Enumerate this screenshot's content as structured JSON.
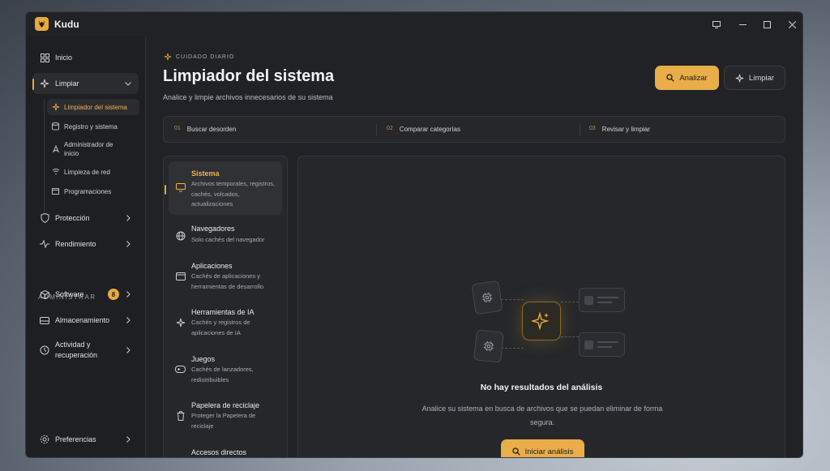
{
  "app": {
    "title": "Kudu"
  },
  "sidebar": {
    "items": [
      {
        "label": "Inicio",
        "icon": "grid-icon"
      },
      {
        "label": "Limpiar",
        "icon": "sparkles-icon",
        "active": true
      },
      {
        "label": "Protección",
        "icon": "shield-icon"
      },
      {
        "label": "Rendimiento",
        "icon": "pulse-icon"
      }
    ],
    "subitems": [
      {
        "label": "Limpiador del sistema",
        "icon": "sparkles-icon",
        "active": true
      },
      {
        "label": "Registro y sistema",
        "icon": "database-icon"
      },
      {
        "label": "Administrador de inicio",
        "icon": "rocket-icon"
      },
      {
        "label": "Limpieza de red",
        "icon": "wifi-icon"
      },
      {
        "label": "Programaciones",
        "icon": "calendar-icon"
      }
    ],
    "section_label": "ADMINISTRAR",
    "admin_items": [
      {
        "label": "Software",
        "icon": "box-icon",
        "badge": "8"
      },
      {
        "label": "Almacenamiento",
        "icon": "drive-icon"
      },
      {
        "label": "Actividad y recuperación",
        "icon": "history-icon"
      }
    ],
    "footer": {
      "label": "Preferencias",
      "icon": "gear-icon"
    }
  },
  "header": {
    "eyebrow": "CUIDADO DIARIO",
    "title": "Limpiador del sistema",
    "subtitle": "Analice y limpie archivos innecesarios de su sistema",
    "analyze_label": "Analizar",
    "clean_label": "Limpiar"
  },
  "steps": [
    {
      "num": "01",
      "label": "Buscar desorden"
    },
    {
      "num": "02",
      "label": "Comparar categorías"
    },
    {
      "num": "03",
      "label": "Revisar y limpiar"
    }
  ],
  "categories": [
    {
      "title": "Sistema",
      "desc": "Archivos temporales, registros, cachés, volcados, actualizaciones",
      "icon": "monitor-icon",
      "active": true
    },
    {
      "title": "Navegadores",
      "desc": "Solo cachés del navegador",
      "icon": "globe-icon"
    },
    {
      "title": "Aplicaciones",
      "desc": "Cachés de aplicaciones y herramientas de desarrollo",
      "icon": "window-icon"
    },
    {
      "title": "Herramientas de IA",
      "desc": "Cachés y registros de aplicaciones de IA",
      "icon": "sparkles-icon"
    },
    {
      "title": "Juegos",
      "desc": "Cachés de lanzadores, redistribuibles",
      "icon": "gamepad-icon"
    },
    {
      "title": "Papelera de reciclaje",
      "desc": "Proteger la Papelera de reciclaje",
      "icon": "trash-icon"
    },
    {
      "title": "Accesos directos",
      "desc": "",
      "icon": "link-icon"
    }
  ],
  "empty_state": {
    "title": "No hay resultados del análisis",
    "description": "Analice su sistema en busca de archivos que se puedan eliminar de forma segura.",
    "button_label": "Iniciar análisis"
  },
  "colors": {
    "accent": "#e9ad49",
    "bg": "#202226",
    "panel": "#25272a"
  }
}
